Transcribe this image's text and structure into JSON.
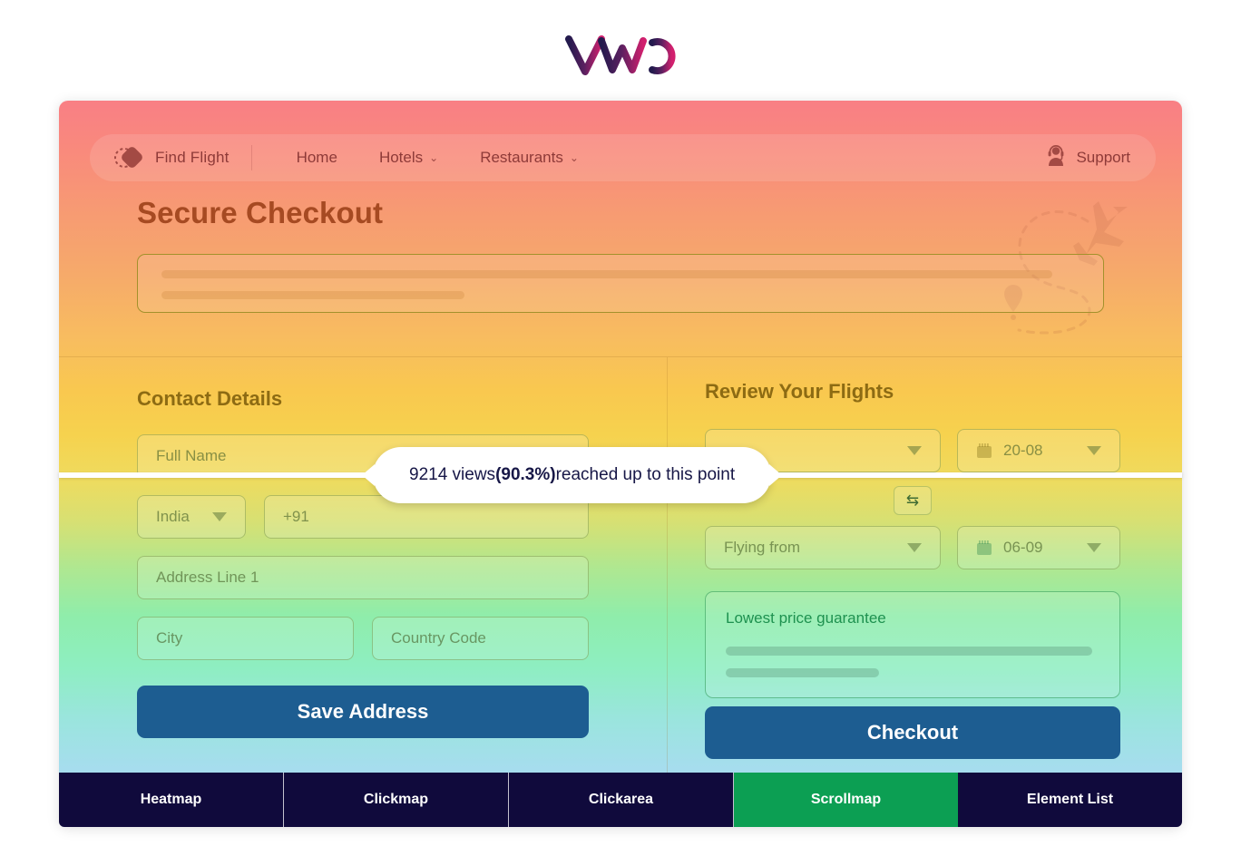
{
  "brand": {
    "logo_text": "VWO"
  },
  "nav": {
    "logo_icon": "diamond-logo-icon",
    "brand_label": "Find Flight",
    "items": [
      {
        "label": "Home",
        "caret": ""
      },
      {
        "label": "Hotels",
        "caret": "⌄"
      },
      {
        "label": "Restaurants",
        "caret": "⌄"
      }
    ],
    "support": {
      "label": "Support",
      "icon": "support-headset-icon"
    }
  },
  "hero": {
    "title": "Secure Checkout"
  },
  "contact": {
    "section_title": "Contact Details",
    "full_name_placeholder": "Full Name",
    "country_value": "India",
    "phone_placeholder": "+91",
    "address_placeholder": "Address Line 1",
    "city_placeholder": "City",
    "country_code_placeholder": "Country Code",
    "save_button": "Save Address"
  },
  "review": {
    "section_title": "Review Your Flights",
    "flying_to_placeholder": "",
    "depart_date": "20-08",
    "swap_icon": "swap-arrows-icon",
    "flying_from_placeholder": "Flying from",
    "return_date": "06-09",
    "promo_title": "Lowest price guarantee",
    "checkout_button": "Checkout"
  },
  "scrollmap": {
    "tooltip_prefix": "9214 views ",
    "tooltip_percent": "(90.3%)",
    "tooltip_suffix": " reached up to this point",
    "views": 9214,
    "percent": "90.3%"
  },
  "tabs": {
    "items": [
      {
        "label": "Heatmap",
        "active": false
      },
      {
        "label": "Clickmap",
        "active": false
      },
      {
        "label": "Clickarea",
        "active": false
      },
      {
        "label": "Scrollmap",
        "active": true
      },
      {
        "label": "Element List",
        "active": false
      }
    ],
    "active_color": "#0c9f53",
    "bar_color": "#100a3c"
  },
  "colors": {
    "heat_top": "#f97f85",
    "heat_mid_orange": "#f8bd5f",
    "heat_mid_yellow": "#f6d24e",
    "heat_green": "#8fedab",
    "heat_bottom": "#a9dcf6",
    "scroll_line": "#ffffff",
    "button_primary": "#1d5d91",
    "title_color": "#a64a22",
    "section_title_color": "#8d6b13"
  }
}
